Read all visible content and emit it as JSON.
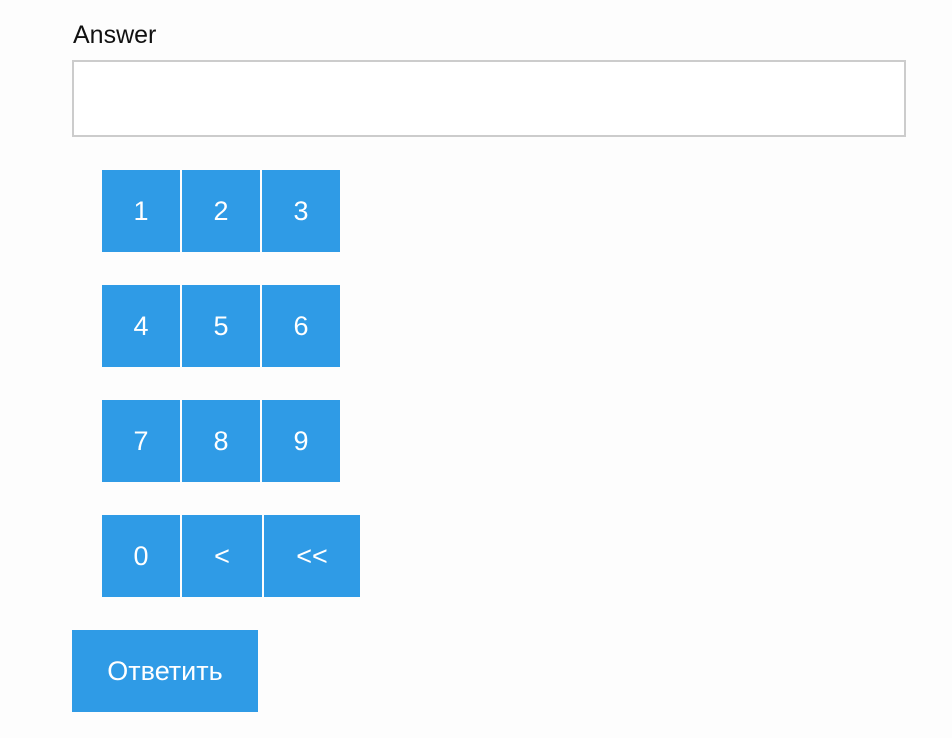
{
  "form": {
    "answer_label": "Answer",
    "answer_value": "",
    "submit_label": "Ответить"
  },
  "keypad": {
    "rows": [
      [
        "1",
        "2",
        "3"
      ],
      [
        "4",
        "5",
        "6"
      ],
      [
        "7",
        "8",
        "9"
      ],
      [
        "0",
        "<",
        "<<"
      ]
    ]
  },
  "colors": {
    "button_bg": "#2f9be6",
    "button_text": "#ffffff",
    "input_border": "#cccccc"
  }
}
